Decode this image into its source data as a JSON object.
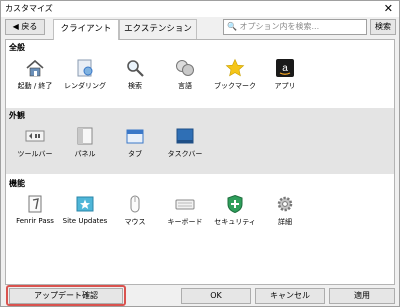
{
  "window": {
    "title": "カスタマイズ",
    "close_glyph": "✕"
  },
  "toolbar": {
    "back_label": "◀ 戻る",
    "tabs": [
      {
        "label": "クライアント"
      },
      {
        "label": "エクステンション"
      }
    ],
    "search_placeholder": "🔍 オプション内を検索...",
    "search_button": "検索"
  },
  "sections": [
    {
      "title": "全般",
      "items": [
        {
          "label": "起動 / 終了",
          "icon": "home-icon"
        },
        {
          "label": "レンダリング",
          "icon": "rendering-icon"
        },
        {
          "label": "検索",
          "icon": "magnifier-icon"
        },
        {
          "label": "言語",
          "icon": "language-icon"
        },
        {
          "label": "ブックマーク",
          "icon": "star-icon"
        },
        {
          "label": "アプリ",
          "icon": "amazon-app-icon"
        }
      ]
    },
    {
      "title": "外観",
      "items": [
        {
          "label": "ツールバー",
          "icon": "toolbar-icon"
        },
        {
          "label": "パネル",
          "icon": "panel-icon"
        },
        {
          "label": "タブ",
          "icon": "tab-icon"
        },
        {
          "label": "タスクバー",
          "icon": "taskbar-icon"
        }
      ]
    },
    {
      "title": "機能",
      "items": [
        {
          "label": "Fenrir Pass",
          "icon": "fenrir-pass-icon"
        },
        {
          "label": "Site Updates",
          "icon": "site-updates-icon"
        },
        {
          "label": "マウス",
          "icon": "mouse-icon"
        },
        {
          "label": "キーボード",
          "icon": "keyboard-icon"
        },
        {
          "label": "セキュリティ",
          "icon": "shield-icon"
        },
        {
          "label": "詳細",
          "icon": "gear-icon"
        }
      ]
    }
  ],
  "footer": {
    "update_check_label": "アップデート確認",
    "ok_label": "OK",
    "cancel_label": "キャンセル",
    "apply_label": "適用"
  },
  "colors": {
    "highlight": "#d9534f",
    "star": "#f5c518",
    "shield": "#2e9e5b",
    "blue": "#3a78c8"
  }
}
